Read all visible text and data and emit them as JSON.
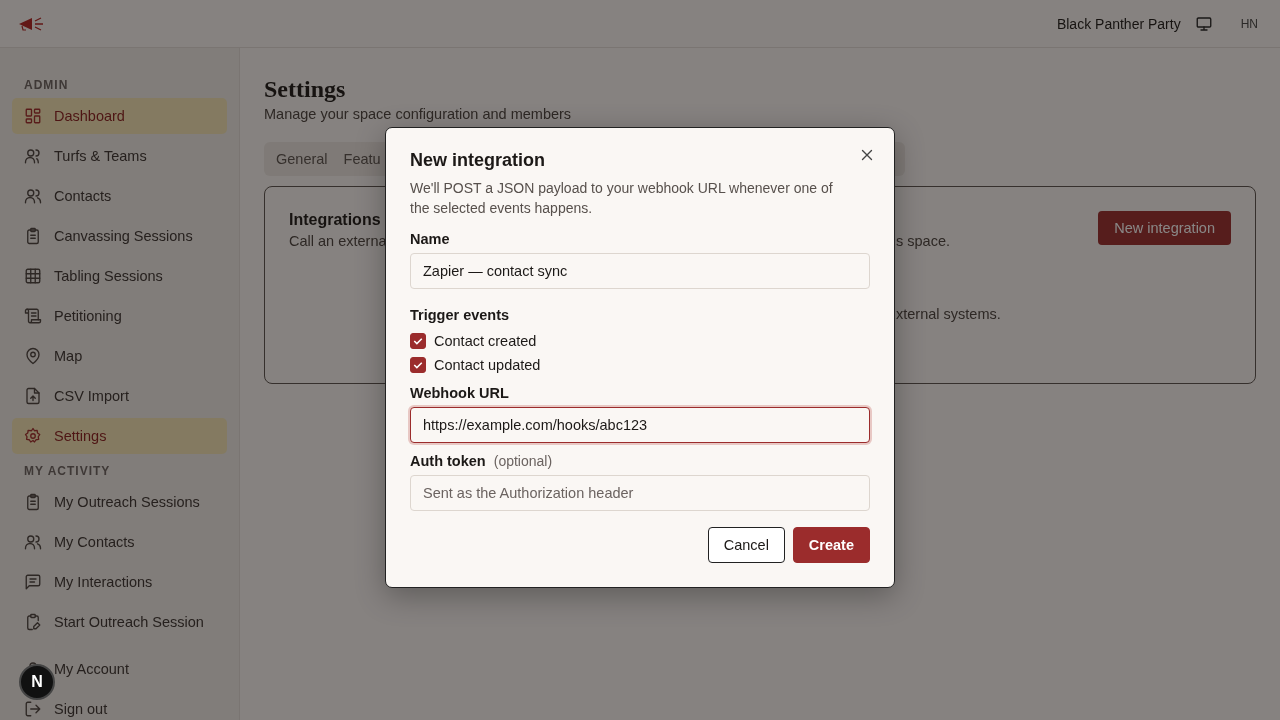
{
  "header": {
    "org_name": "Black Panther Party",
    "user_initials": "HN"
  },
  "sidebar": {
    "sections": [
      {
        "title": "ADMIN",
        "items": [
          {
            "label": "Dashboard",
            "selected": true
          },
          {
            "label": "Turfs & Teams",
            "selected": false
          },
          {
            "label": "Contacts",
            "selected": false
          },
          {
            "label": "Canvassing Sessions",
            "selected": false
          },
          {
            "label": "Tabling Sessions",
            "selected": false
          },
          {
            "label": "Petitioning",
            "selected": false
          },
          {
            "label": "Map",
            "selected": false
          },
          {
            "label": "CSV Import",
            "selected": false
          },
          {
            "label": "Settings",
            "selected": true
          }
        ]
      },
      {
        "title": "MY ACTIVITY",
        "items": [
          {
            "label": "My Outreach Sessions",
            "selected": false
          },
          {
            "label": "My Contacts",
            "selected": false
          },
          {
            "label": "My Interactions",
            "selected": false
          },
          {
            "label": "Start Outreach Session",
            "selected": false
          }
        ]
      }
    ],
    "footer": [
      {
        "label": "My Account"
      },
      {
        "label": "Sign out"
      }
    ]
  },
  "dev_badge": "N",
  "page": {
    "title": "Settings",
    "subtitle": "Manage your space configuration and members",
    "tabs": [
      {
        "label": "General",
        "selected": false
      },
      {
        "label": "Featu",
        "selected": false
      }
    ],
    "card": {
      "title": "Integrations",
      "description_start": "Call an externa",
      "description_end": "s space.",
      "button": "New integration",
      "empty_text": "xternal systems."
    }
  },
  "dialog": {
    "title": "New integration",
    "description": "We'll POST a JSON payload to your webhook URL whenever one of the selected events happens.",
    "name_label": "Name",
    "name_value": "Zapier — contact sync",
    "events_label": "Trigger events",
    "events": [
      {
        "label": "Contact created",
        "checked": true
      },
      {
        "label": "Contact updated",
        "checked": true
      }
    ],
    "url_label": "Webhook URL",
    "url_value": "https://example.com/hooks/abc123",
    "url_focused": true,
    "token_label": "Auth token",
    "token_hint": "(optional)",
    "token_placeholder": "Sent as the Authorization header",
    "buttons": [
      {
        "label": "Cancel",
        "kind": "secondary"
      },
      {
        "label": "Create",
        "kind": "primary"
      }
    ]
  }
}
